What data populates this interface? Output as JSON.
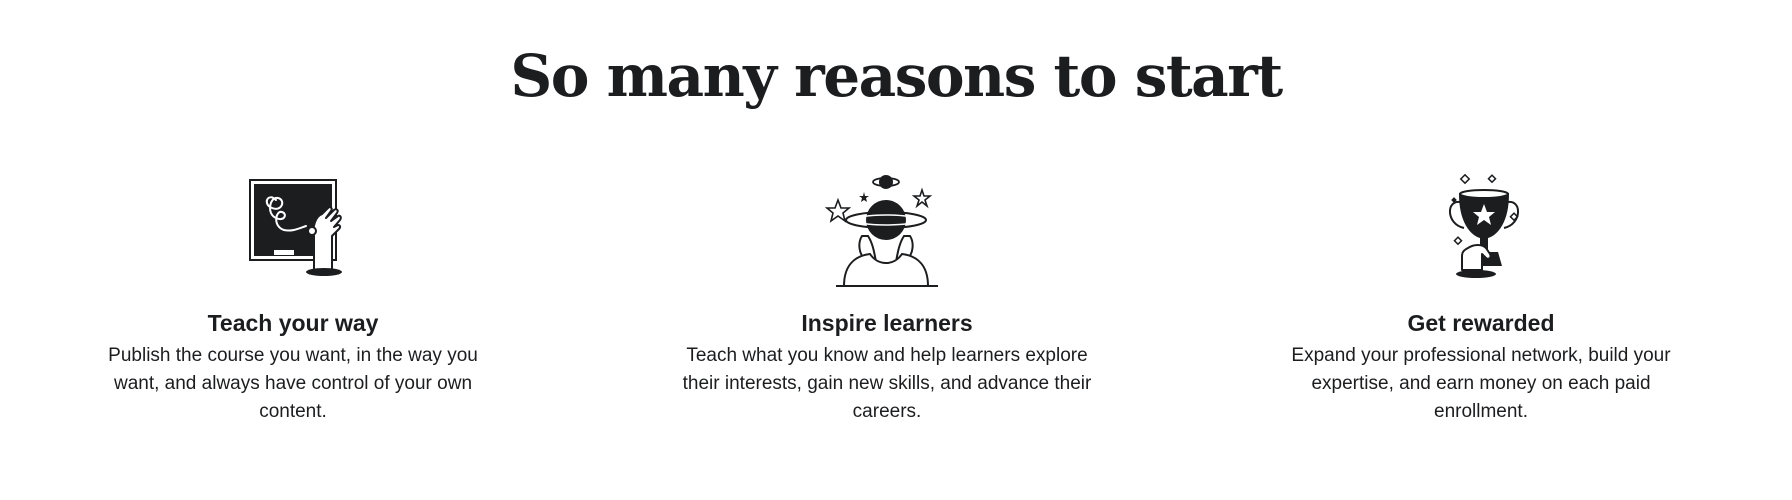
{
  "section": {
    "title": "So many reasons to start",
    "cards": [
      {
        "icon": "chalkboard-hand-icon",
        "heading": "Teach your way",
        "text": "Publish the course you want, in the way you want, and always have control of your own content."
      },
      {
        "icon": "planet-head-person-icon",
        "heading": "Inspire learners",
        "text": "Teach what you know and help learners explore their interests, gain new skills, and advance their careers."
      },
      {
        "icon": "trophy-hand-icon",
        "heading": "Get rewarded",
        "text": "Expand your professional network, build your expertise, and earn money on each paid enrollment."
      }
    ]
  }
}
